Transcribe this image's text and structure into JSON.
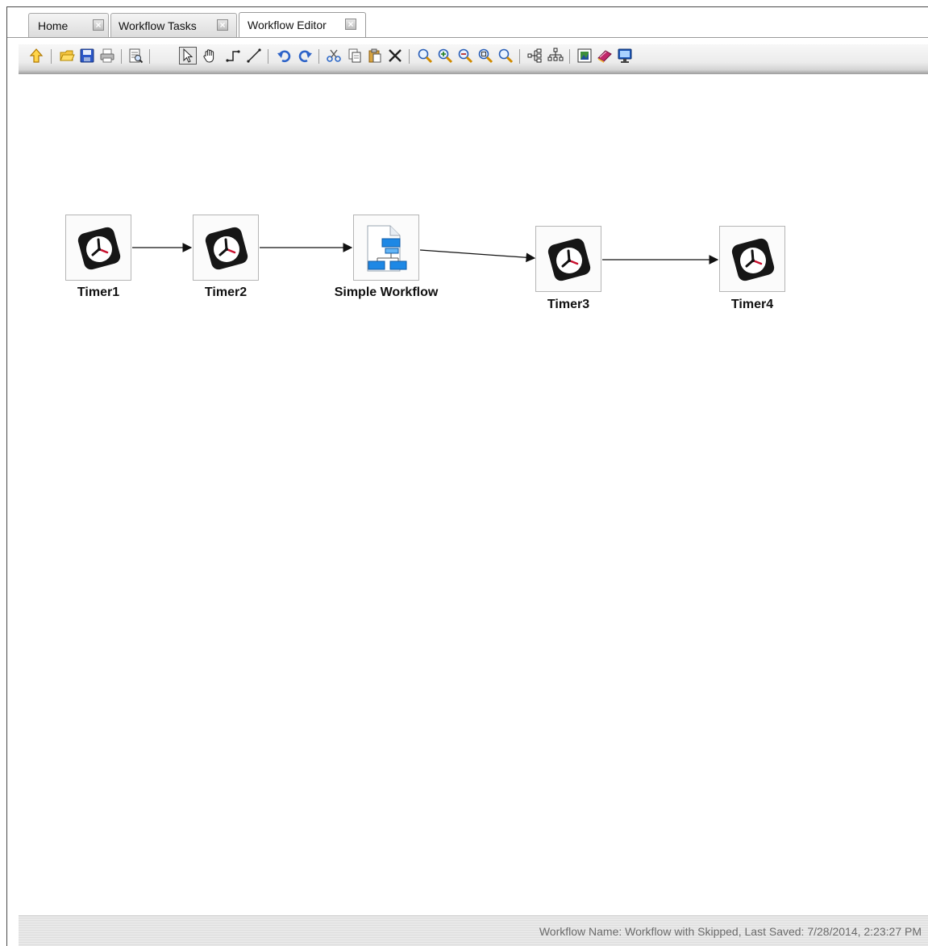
{
  "tabs": [
    {
      "label": "Home",
      "active": false
    },
    {
      "label": "Workflow Tasks",
      "active": false
    },
    {
      "label": "Workflow Editor",
      "active": true
    }
  ],
  "toolbar": {
    "tools": [
      "up-arrow-icon",
      "open-folder-icon",
      "save-icon",
      "print-icon",
      "print-preview-icon",
      "select-pointer-icon",
      "pan-hand-icon",
      "orthogonal-connector-icon",
      "straight-connector-icon",
      "undo-icon",
      "redo-icon",
      "cut-icon",
      "copy-icon",
      "paste-icon",
      "delete-icon",
      "zoom-icon",
      "zoom-in-icon",
      "zoom-out-icon",
      "zoom-fit-icon",
      "zoom-actual-icon",
      "horizontal-layout-icon",
      "tree-layout-icon",
      "export-image-icon",
      "book-icon",
      "monitor-icon"
    ]
  },
  "workflow": {
    "nodes": [
      {
        "id": "timer1",
        "label": "Timer1",
        "type": "timer"
      },
      {
        "id": "timer2",
        "label": "Timer2",
        "type": "timer"
      },
      {
        "id": "simple-workflow",
        "label": "Simple Workflow",
        "type": "workflow"
      },
      {
        "id": "timer3",
        "label": "Timer3",
        "type": "timer"
      },
      {
        "id": "timer4",
        "label": "Timer4",
        "type": "timer"
      }
    ],
    "edges": [
      {
        "from": "timer1",
        "to": "timer2"
      },
      {
        "from": "timer2",
        "to": "simple-workflow"
      },
      {
        "from": "simple-workflow",
        "to": "timer3"
      },
      {
        "from": "timer3",
        "to": "timer4"
      }
    ]
  },
  "status": {
    "text": "Workflow Name: Workflow with Skipped, Last Saved: 7/28/2014, 2:23:27 PM"
  },
  "colors": {
    "accent_blue": "#1e88e5",
    "toolbar_gold": "#f0b400",
    "timer_red": "#c8102e"
  }
}
